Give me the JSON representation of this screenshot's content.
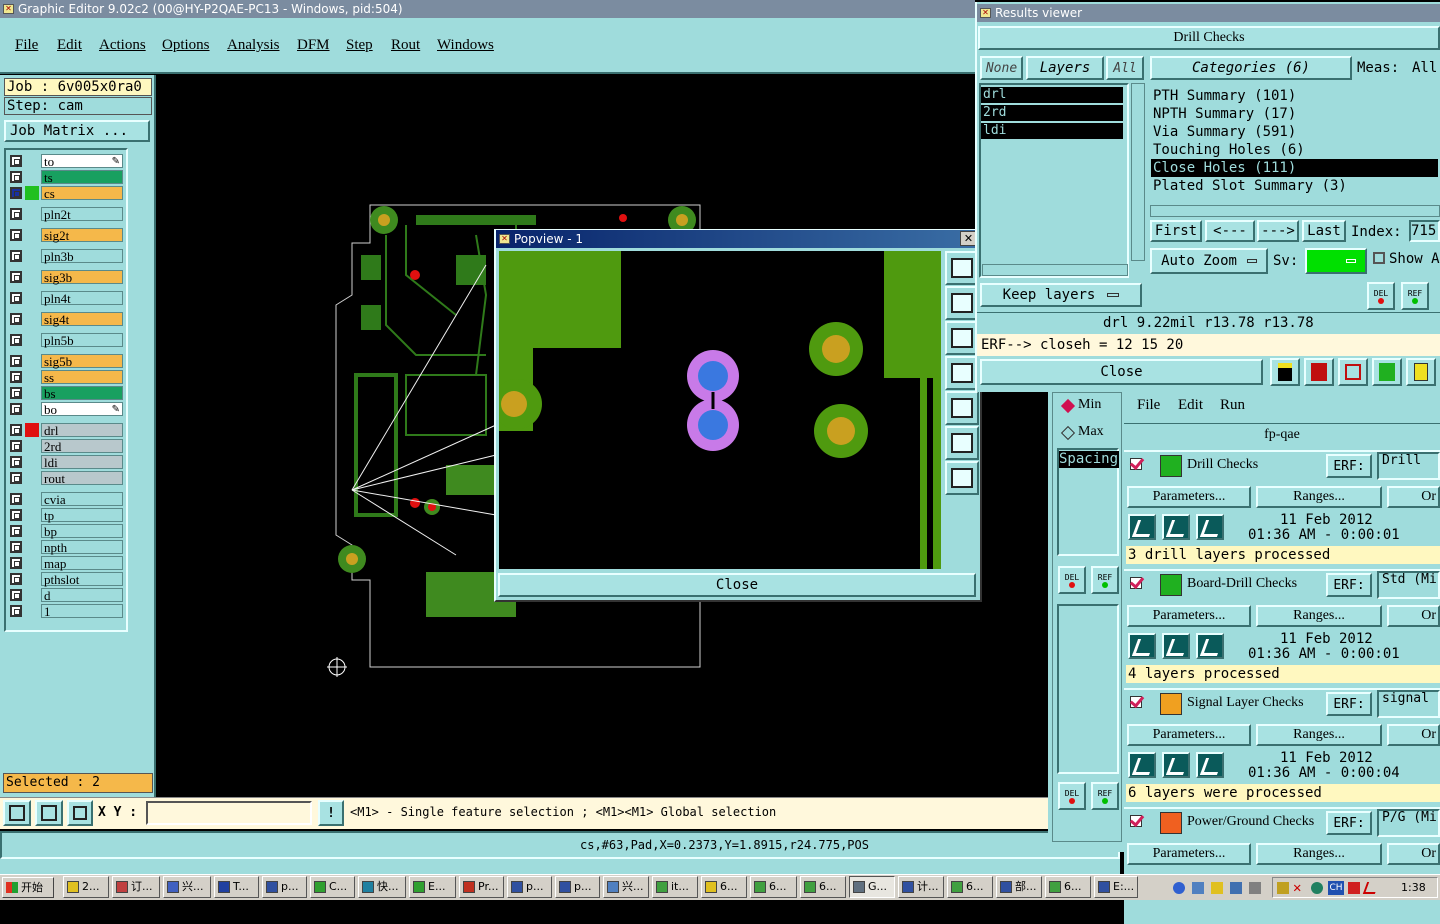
{
  "main_window": {
    "title": "Graphic Editor 9.02c2 (00@HY-P2QAE-PC13 - Windows, pid:504)",
    "menu": [
      "File",
      "Edit",
      "Actions",
      "Options",
      "Analysis",
      "DFM",
      "Step",
      "Rout",
      "Windows"
    ],
    "job_label": "Job : 6v005x0ra0",
    "step_label": "Step: cam",
    "job_matrix_button": "Job Matrix ...",
    "layers": [
      {
        "name": "to",
        "color": "#ffffff",
        "mark": "pencil"
      },
      {
        "name": "ts",
        "color": "#18a060",
        "mark": ""
      },
      {
        "name": "cs",
        "color": "#f5b84a",
        "mark": "active"
      },
      {
        "name": "pln2t",
        "color": "#9fdcdc",
        "mark": ""
      },
      {
        "name": "sig2t",
        "color": "#f5b84a",
        "mark": ""
      },
      {
        "name": "pln3b",
        "color": "#9fdcdc",
        "mark": ""
      },
      {
        "name": "sig3b",
        "color": "#f5b84a",
        "mark": ""
      },
      {
        "name": "pln4t",
        "color": "#9fdcdc",
        "mark": ""
      },
      {
        "name": "sig4t",
        "color": "#f5b84a",
        "mark": ""
      },
      {
        "name": "pln5b",
        "color": "#9fdcdc",
        "mark": ""
      },
      {
        "name": "sig5b",
        "color": "#f5b84a",
        "mark": ""
      },
      {
        "name": "ss",
        "color": "#f5b84a",
        "mark": ""
      },
      {
        "name": "bs",
        "color": "#18a060",
        "mark": ""
      },
      {
        "name": "bo",
        "color": "#ffffff",
        "mark": "pencil"
      },
      {
        "name": "drl",
        "color": "#b8c8cc",
        "mark": "red"
      },
      {
        "name": "2rd",
        "color": "#b8c8cc",
        "mark": ""
      },
      {
        "name": "ldi",
        "color": "#b8c8cc",
        "mark": ""
      },
      {
        "name": "rout",
        "color": "#b8c8cc",
        "mark": ""
      },
      {
        "name": "cvia",
        "color": "#9fdcdc",
        "mark": ""
      },
      {
        "name": "tp",
        "color": "#9fdcdc",
        "mark": ""
      },
      {
        "name": "bp",
        "color": "#9fdcdc",
        "mark": ""
      },
      {
        "name": "npth",
        "color": "#9fdcdc",
        "mark": ""
      },
      {
        "name": "map",
        "color": "#9fdcdc",
        "mark": ""
      },
      {
        "name": "pthslot",
        "color": "#9fdcdc",
        "mark": ""
      },
      {
        "name": "d",
        "color": "#9fdcdc",
        "mark": ""
      },
      {
        "name": "1",
        "color": "#9fdcdc",
        "mark": ""
      }
    ],
    "selected": "Selected : 2",
    "xy_label": "X Y :",
    "hint": "<M1> - Single feature selection ; <M1><M1> Global selection",
    "status": "cs,#63,Pad,X=0.2373,Y=1.8915,r24.775,POS"
  },
  "popview": {
    "title": "Popview - 1",
    "close_label": "Close"
  },
  "results_viewer": {
    "title": "Results viewer",
    "header": "Drill Checks",
    "btn_none": "None",
    "btn_layers": "Layers",
    "btn_all": "All",
    "categories_label": "Categories (6)",
    "meas_label": "Meas:",
    "meas_all": "All",
    "layer_list": [
      "drl",
      "2rd",
      "ldi"
    ],
    "categories": [
      "PTH Summary (101)",
      "NPTH Summary (17)",
      "Via Summary (591)",
      "Touching Holes (6)",
      "Close Holes (111)",
      "Plated Slot Summary (3)"
    ],
    "selected_category": 4,
    "nav": {
      "first": "First",
      "prev": "<---",
      "next": "--->",
      "last": "Last",
      "index_label": "Index:",
      "index_value": "715"
    },
    "auto_zoom": "Auto Zoom",
    "sv_label": "Sv:",
    "show_label": "Show A",
    "keep_layers": "Keep layers",
    "meas_line": "drl 9.22mil  r13.78  r13.78",
    "erf_line": "ERF--> closeh = 12 15 20",
    "close_label": "Close",
    "del": "DEL",
    "ref": "REF"
  },
  "checklist": {
    "min_label": "Min",
    "max_label": "Max",
    "spacing_label": "Spacing",
    "menu": [
      "File",
      "Edit",
      "Run"
    ],
    "name": "fp-qae",
    "params_label": "Parameters...",
    "ranges_label": "Ranges...",
    "or_label": "Or",
    "erf_label": "ERF:",
    "checks": [
      {
        "name": "Drill Checks",
        "erf": "Drill",
        "date": "11 Feb 2012",
        "time": "01:36 AM - 0:00:01",
        "status": "3 drill layers processed"
      },
      {
        "name": "Board-Drill Checks",
        "erf": "Std (Mi",
        "date": "11 Feb 2012",
        "time": "01:36 AM - 0:00:01",
        "status": "4 layers processed"
      },
      {
        "name": "Signal Layer Checks",
        "erf": "signal",
        "date": "11 Feb 2012",
        "time": "01:36 AM - 0:00:04",
        "status": "6 layers were processed"
      },
      {
        "name": "Power/Ground Checks",
        "erf": "P/G (Mi",
        "date": "",
        "time": "",
        "status": ""
      }
    ]
  },
  "taskbar": {
    "start": "开始",
    "tasks": [
      "2...",
      "订...",
      "兴...",
      "T...",
      "p...",
      "C...",
      "快...",
      "E...",
      "Pr...",
      "p...",
      "p...",
      "兴...",
      "it...",
      "6...",
      "6...",
      "6...",
      "G...",
      "计...",
      "6...",
      "部...",
      "6...",
      "E:..."
    ],
    "lang": "CH",
    "clock": "1:38"
  }
}
